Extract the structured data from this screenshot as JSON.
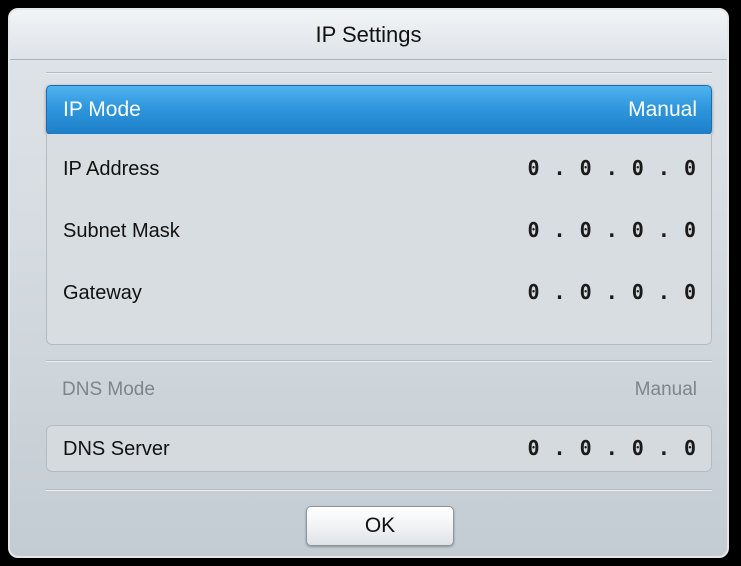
{
  "dialog": {
    "title": "IP Settings"
  },
  "ip_mode": {
    "label": "IP Mode",
    "value": "Manual",
    "selected": true
  },
  "ip_fields": [
    {
      "label": "IP Address",
      "value": "0 . 0 . 0 . 0"
    },
    {
      "label": "Subnet Mask",
      "value": "0 . 0 . 0 . 0"
    },
    {
      "label": "Gateway",
      "value": "0 . 0 . 0 . 0"
    }
  ],
  "dns_mode": {
    "label": "DNS Mode",
    "value": "Manual",
    "disabled": true
  },
  "dns_server": {
    "label": "DNS Server",
    "value": "0 . 0 . 0 . 0"
  },
  "buttons": {
    "ok_label": "OK"
  },
  "colors": {
    "accent": "#2f97dd",
    "dialog_background": "#d6dce1",
    "disabled_text": "#7f858a"
  }
}
